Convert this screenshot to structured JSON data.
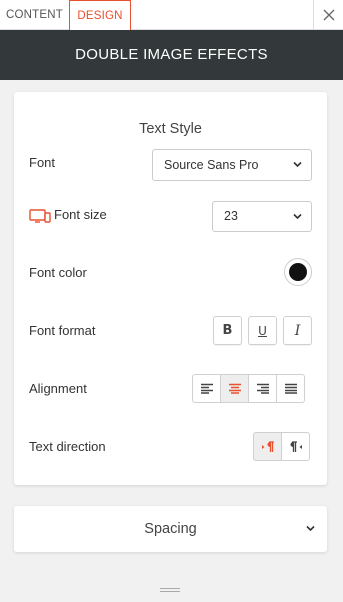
{
  "tabs": [
    {
      "label": "CONTENT",
      "active": false
    },
    {
      "label": "DESIGN",
      "active": true
    }
  ],
  "header": {
    "title": "DOUBLE IMAGE EFFECTS"
  },
  "text_style": {
    "title": "Text Style",
    "font": {
      "label": "Font",
      "value": "Source Sans Pro"
    },
    "font_size": {
      "label": "Font size",
      "value": "23"
    },
    "font_color": {
      "label": "Font color",
      "color": "#111111"
    },
    "font_format": {
      "label": "Font format",
      "bold": "B",
      "underline": "U",
      "italic": "I"
    },
    "alignment": {
      "label": "Alignment",
      "selected": "center",
      "options": [
        "left",
        "center",
        "right",
        "justify"
      ]
    },
    "text_direction": {
      "label": "Text direction",
      "selected": "ltr",
      "options": [
        "ltr",
        "rtl"
      ]
    }
  },
  "spacing": {
    "label": "Spacing"
  },
  "colors": {
    "accent": "#e8502e",
    "header_bg": "#33393a"
  }
}
